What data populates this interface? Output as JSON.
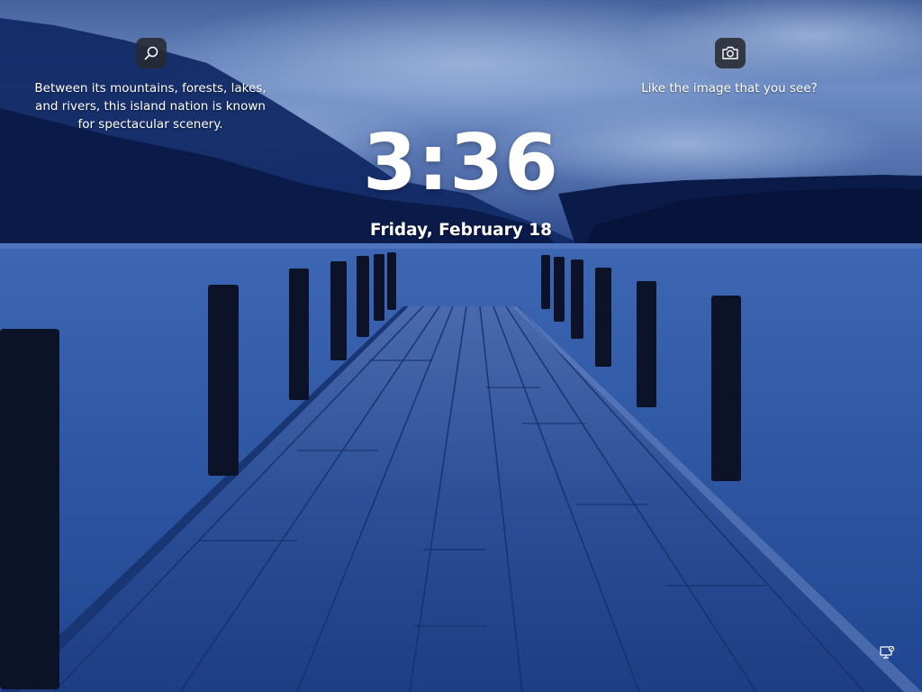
{
  "lock_screen": {
    "clock": {
      "time": "3:36"
    },
    "date": {
      "text": "Friday, February 18"
    },
    "spotlight": {
      "info_icon": "search-icon",
      "info_caption": "Between its mountains, forests, lakes, and rivers, this island nation is known for spectacular scenery.",
      "camera_icon": "camera-icon",
      "camera_caption": "Like the image that you see?"
    },
    "status": {
      "network_icon": "network-icon"
    },
    "colors": {
      "sky": "#5a78b2",
      "mountains": "#0b1f55",
      "water": "#2f57a3",
      "pier": "#2b4e95",
      "posts": "#0c1328",
      "text": "#ffffff"
    }
  }
}
